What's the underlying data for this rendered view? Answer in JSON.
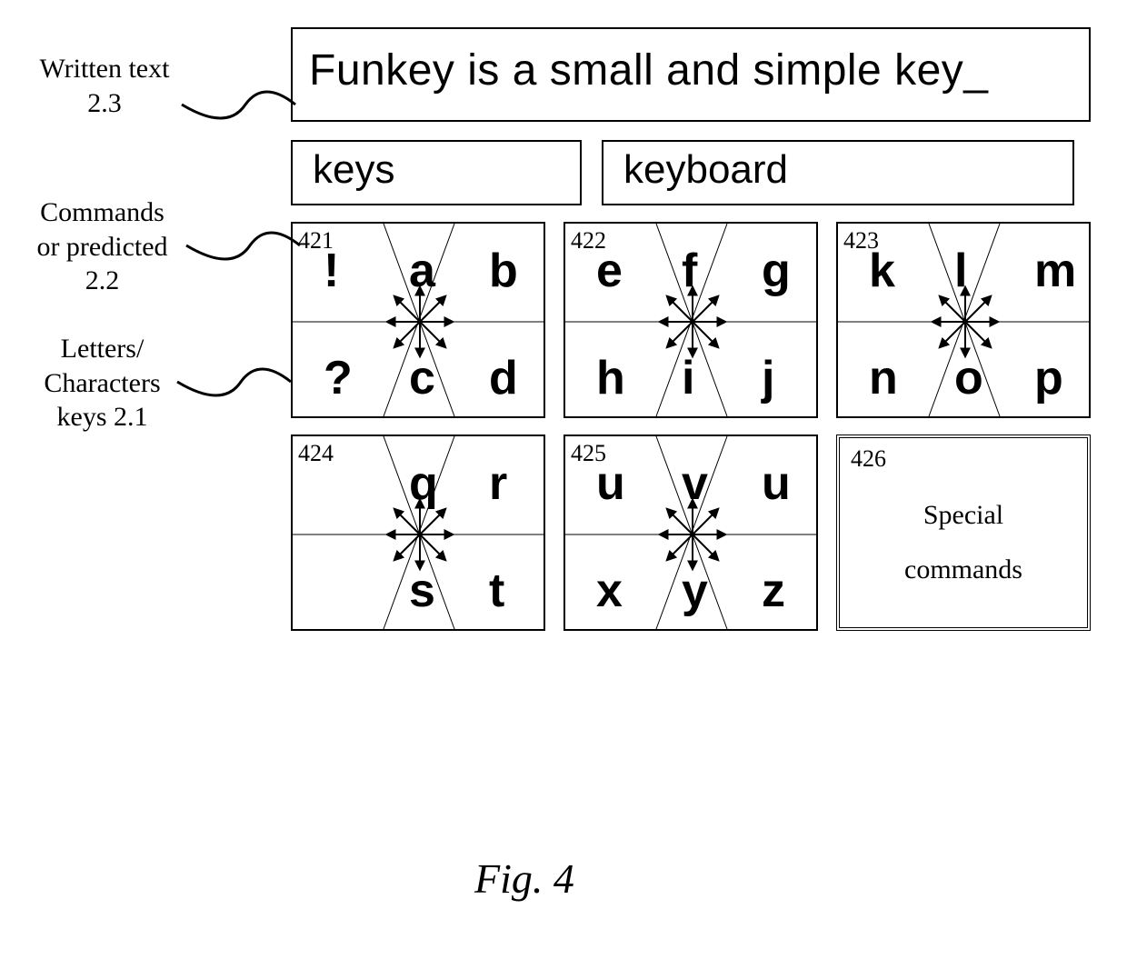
{
  "annotations": {
    "written_text": "Written text\n2.3",
    "commands_predicted": "Commands\nor predicted\n2.2",
    "letters_keys": "Letters/\nCharacters\nkeys 2.1"
  },
  "text_output": "Funkey is a small and simple key_",
  "predictions": {
    "first": "keys",
    "second": "keyboard"
  },
  "cells": [
    {
      "ref": "421",
      "letters": {
        "tl": "!",
        "tc": "a",
        "tr": "b",
        "bl": "?",
        "bc": "c",
        "br": "d"
      }
    },
    {
      "ref": "422",
      "letters": {
        "tl": "e",
        "tc": "f",
        "tr": "g",
        "bl": "h",
        "bc": "i",
        "br": "j"
      }
    },
    {
      "ref": "423",
      "letters": {
        "tl": "k",
        "tc": "l",
        "tr": "m",
        "bl": "n",
        "bc": "o",
        "br": "p"
      }
    },
    {
      "ref": "424",
      "letters": {
        "tl": "",
        "tc": "q",
        "tr": "r",
        "bl": "",
        "bc": "s",
        "br": "t"
      }
    },
    {
      "ref": "425",
      "letters": {
        "tl": "u",
        "tc": "v",
        "tr": "u",
        "bl": "x",
        "bc": "y",
        "br": "z"
      }
    }
  ],
  "special_cell": {
    "ref": "426",
    "label_line1": "Special",
    "label_line2": "commands"
  },
  "figure_caption": "Fig. 4"
}
